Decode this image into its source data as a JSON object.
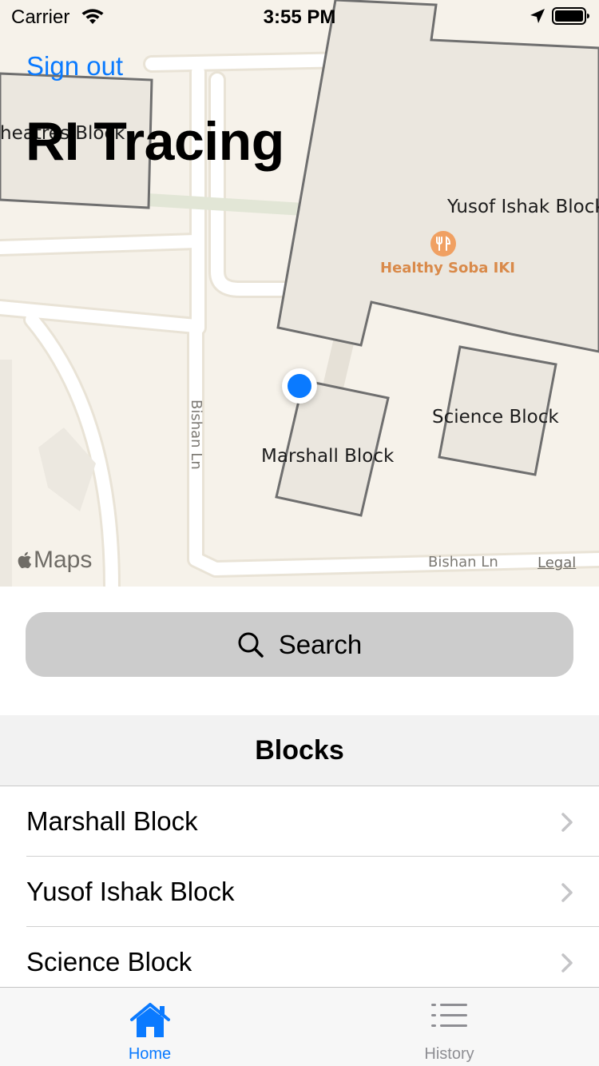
{
  "status_bar": {
    "carrier": "Carrier",
    "time": "3:55 PM"
  },
  "nav": {
    "sign_out_label": "Sign out",
    "title": "RI Tracing"
  },
  "map": {
    "building_labels": {
      "partial_left": "heatres Block",
      "yusof": "Yusof Ishak Block",
      "science": "Science Block",
      "marshall": "Marshall Block"
    },
    "poi_label": "Healthy Soba IKI",
    "road_labels": {
      "vertical": "Bishan Ln",
      "bottom": "Bishan Ln"
    },
    "maps_brand": "Maps",
    "legal_label": "Legal",
    "colors": {
      "land": "#f6f2ea",
      "building_fill": "#ebe7df",
      "building_stroke": "#6f6f6f",
      "road": "#ffffff",
      "poi": "#f0a062",
      "user_location": "#0a7aff"
    }
  },
  "search": {
    "label": "Search"
  },
  "blocks": {
    "header": "Blocks",
    "items": [
      {
        "label": "Marshall Block"
      },
      {
        "label": "Yusof Ishak Block"
      },
      {
        "label": "Science Block"
      }
    ]
  },
  "tab_bar": {
    "tabs": [
      {
        "label": "Home",
        "icon": "house-icon",
        "selected": true
      },
      {
        "label": "History",
        "icon": "list-icon",
        "selected": false
      }
    ],
    "active_color": "#0a7aff",
    "inactive_color": "#8e8e93"
  }
}
